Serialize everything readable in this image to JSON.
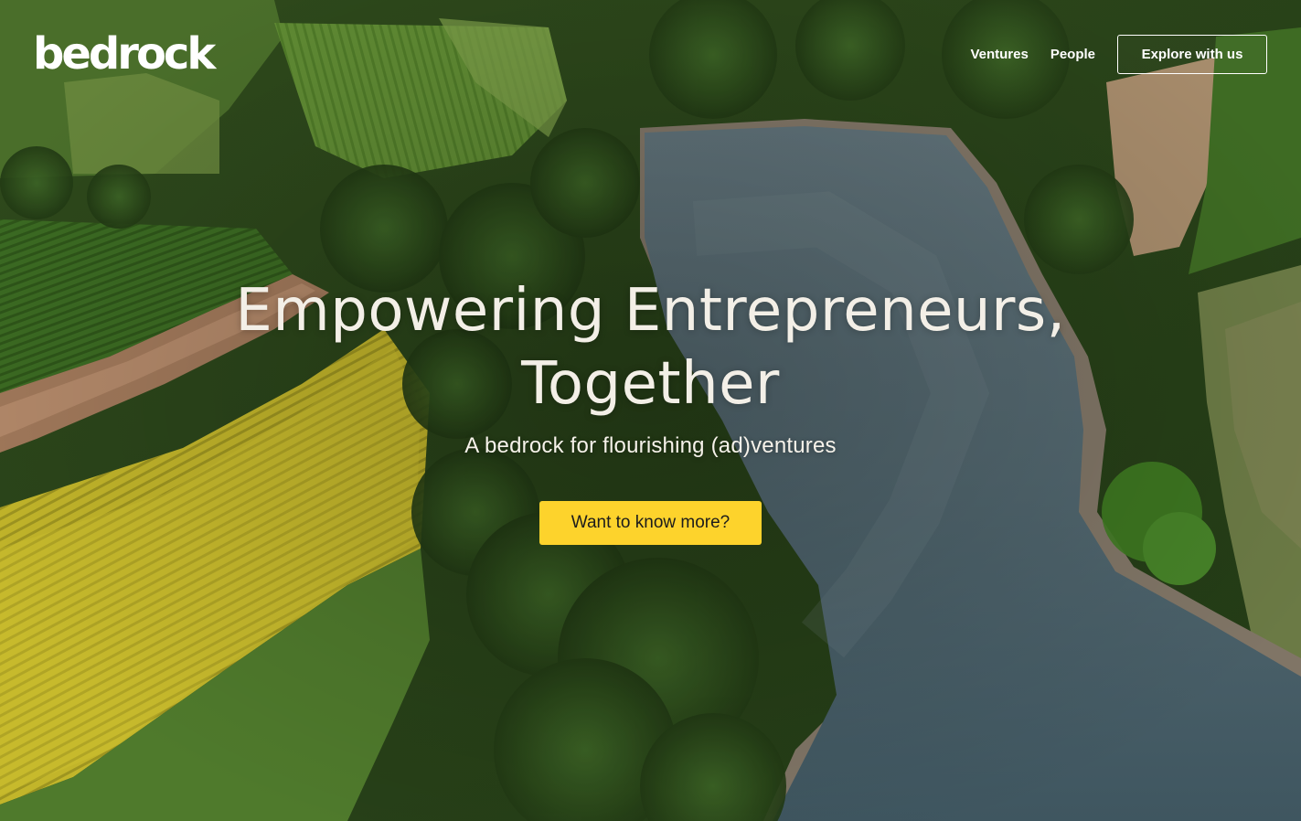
{
  "header": {
    "logo_text": "bedrock",
    "nav": [
      {
        "label": "Ventures"
      },
      {
        "label": "People"
      }
    ],
    "cta_label": "Explore with us"
  },
  "hero": {
    "headline_line1": "Empowering Entrepreneurs,",
    "headline_line2": "Together",
    "subline": "A bedrock for flourishing (ad)ventures",
    "button_label": "Want to know more?"
  },
  "colors": {
    "accent": "#fdd32c",
    "text_light": "#f3efe7",
    "water": "#4f6570"
  }
}
